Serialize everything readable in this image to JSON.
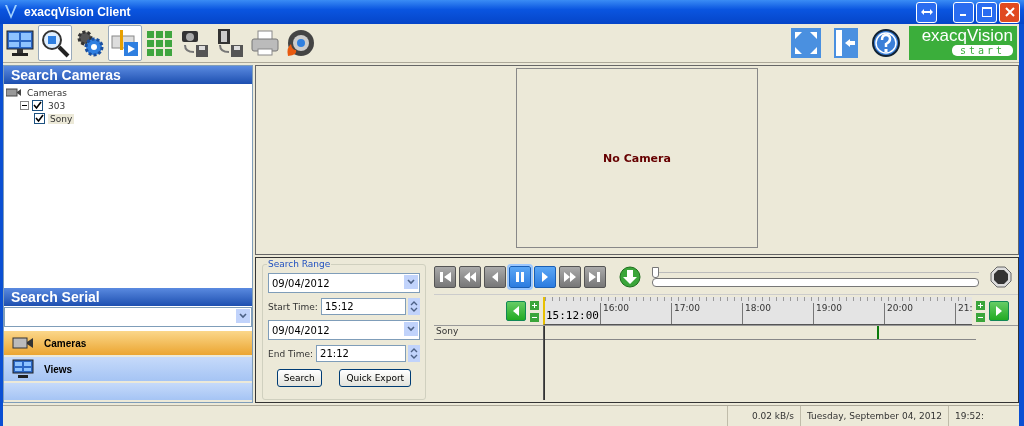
{
  "window": {
    "title": "exacqVision Client"
  },
  "toolbar": [
    {
      "kind": "monitor",
      "selected": false
    },
    {
      "kind": "search",
      "selected": true
    },
    {
      "kind": "settings",
      "selected": false
    },
    {
      "kind": "timeline",
      "selected": true
    },
    {
      "kind": "grid",
      "selected": false
    },
    {
      "kind": "camera-save",
      "selected": false
    },
    {
      "kind": "film-save",
      "selected": false
    },
    {
      "kind": "printer",
      "selected": false
    },
    {
      "kind": "disc",
      "selected": false
    }
  ],
  "toolbar_right": [
    {
      "kind": "fullscreen"
    },
    {
      "kind": "collapse"
    },
    {
      "kind": "help"
    }
  ],
  "logo": {
    "name": "exacqVision",
    "tag": "start"
  },
  "search_cameras": {
    "title": "Search Cameras",
    "tree": [
      {
        "label": "Cameras",
        "kind": "root",
        "selected": false,
        "children": [
          {
            "label": "303",
            "checked": true,
            "expanded": true,
            "selected": false,
            "children": [
              {
                "label": "Sony",
                "checked": true,
                "selected": true
              }
            ]
          }
        ]
      }
    ]
  },
  "search_serial": {
    "title": "Search Serial"
  },
  "nav": [
    {
      "label": "Cameras",
      "kind": "camera",
      "selected": true
    },
    {
      "label": "Views",
      "kind": "monitor",
      "selected": false
    }
  ],
  "video": {
    "message": "No Camera"
  },
  "search_range": {
    "legend": "Search Range",
    "start_date": "09/04/2012",
    "start_label": "Start Time:",
    "start_time": "15:12",
    "end_date": "09/04/2012",
    "end_label": "End Time:",
    "end_time": "21:12",
    "buttons": [
      "Search",
      "Quick Export"
    ]
  },
  "playback": [
    {
      "kind": "first",
      "selected": false
    },
    {
      "kind": "rewind",
      "selected": false
    },
    {
      "kind": "back",
      "selected": false
    },
    {
      "kind": "pause",
      "selected": true
    },
    {
      "kind": "play",
      "selected": false
    },
    {
      "kind": "forward",
      "selected": false
    },
    {
      "kind": "last",
      "selected": false
    }
  ],
  "speed": {
    "level": 0
  },
  "progress": {
    "level": 0
  },
  "timeline": {
    "current": "15:12:00",
    "ticks": [
      "16:00",
      "17:00",
      "18:00",
      "19:00",
      "20:00",
      "21:"
    ],
    "tracks": [
      {
        "name": "Sony",
        "events": [
          {
            "level": 0.77
          }
        ]
      }
    ]
  },
  "status_bar": {
    "rate": "0.02 kB/s",
    "date": "Tuesday, September 04, 2012",
    "time": "19:52:"
  }
}
